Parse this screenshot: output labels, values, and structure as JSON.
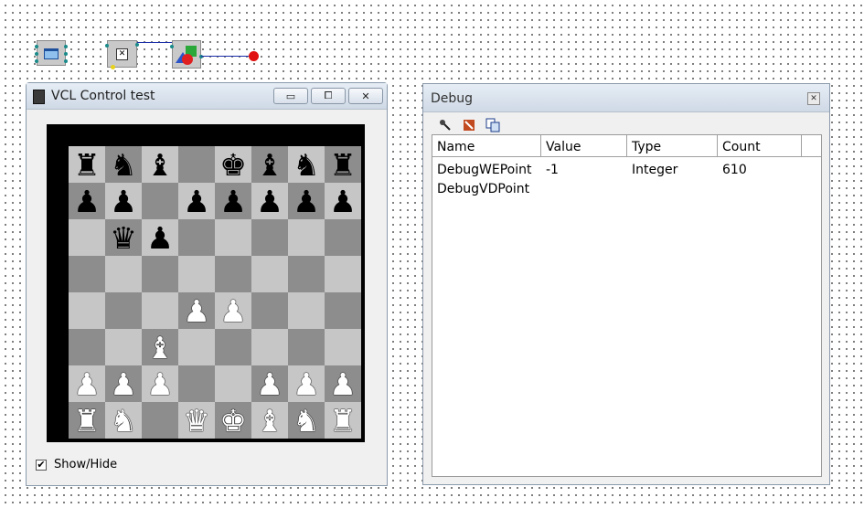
{
  "canvas": {
    "components": [
      {
        "name": "form-component",
        "icon": "window-icon"
      },
      {
        "name": "check-component",
        "icon": "checkbox-x-icon"
      },
      {
        "name": "shapes-component",
        "icon": "shapes-icon"
      }
    ]
  },
  "vcl_window": {
    "title": "VCL Control test",
    "minimize": "▭",
    "restore": "⧠",
    "close": "✕",
    "checkbox_checked": "✔",
    "checkbox_label": "Show/Hide",
    "board": [
      [
        "br",
        "bn",
        "bb",
        "",
        "bk",
        "bb",
        "bn",
        "br"
      ],
      [
        "bp",
        "bp",
        "",
        "bp",
        "bp",
        "bp",
        "bp",
        "bp"
      ],
      [
        "",
        "bq",
        "bp",
        "",
        "",
        "",
        "",
        ""
      ],
      [
        "",
        "",
        "",
        "",
        "",
        "",
        "",
        ""
      ],
      [
        "",
        "",
        "",
        "wp",
        "wp",
        "",
        "",
        ""
      ],
      [
        "",
        "",
        "wb",
        "",
        "",
        "",
        "",
        ""
      ],
      [
        "wp",
        "wp",
        "wp",
        "",
        "",
        "wp",
        "wp",
        "wp"
      ],
      [
        "wr",
        "wn",
        "",
        "wq",
        "wk",
        "wb",
        "wn",
        "wr"
      ]
    ]
  },
  "debug_window": {
    "title": "Debug",
    "close": "✕",
    "columns": [
      "Name",
      "Value",
      "Type",
      "Count"
    ],
    "rows": [
      {
        "name": "DebugWEPoint",
        "value": "-1",
        "type": "Integer",
        "count": "610"
      },
      {
        "name": "DebugVDPoint",
        "value": "",
        "type": "",
        "count": ""
      }
    ]
  }
}
